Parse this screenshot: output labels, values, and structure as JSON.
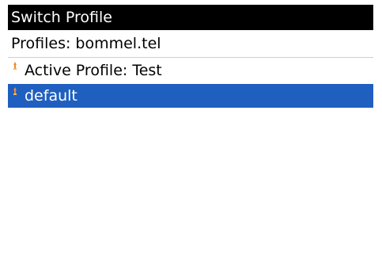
{
  "window": {
    "title": "Switch Profile"
  },
  "header": {
    "profiles_label": "Profiles: bommel.tel"
  },
  "list": {
    "items": [
      {
        "label": "Active Profile: Test",
        "icon": "profile-pin-icon",
        "selected": false
      },
      {
        "label": "default",
        "icon": "profile-pin-icon",
        "selected": true
      }
    ]
  },
  "colors": {
    "titlebar_bg": "#000000",
    "selection_bg": "#1f5fbf",
    "pin_orange": "#f08a2c"
  }
}
